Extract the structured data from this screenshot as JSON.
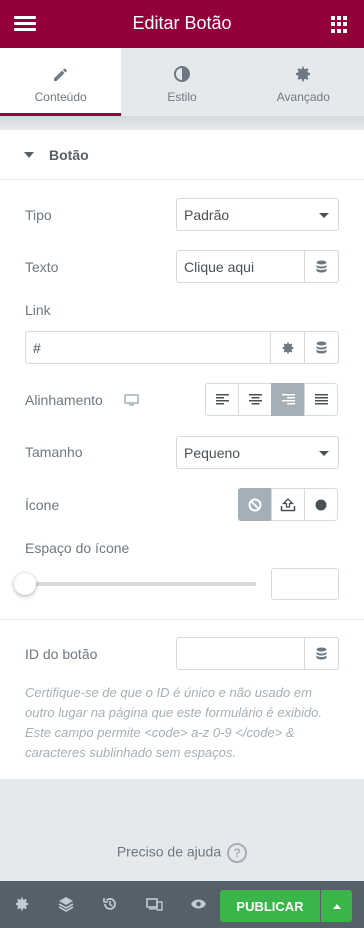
{
  "header": {
    "title": "Editar Botão",
    "menu_icon": "hamburger-icon",
    "apps_icon": "grid-icon",
    "background_color": "#93003c"
  },
  "tabs": [
    {
      "label": "Conteúdo",
      "icon": "pencil-icon",
      "active": true
    },
    {
      "label": "Estilo",
      "icon": "contrast-icon",
      "active": false
    },
    {
      "label": "Avançado",
      "icon": "gear-icon",
      "active": false
    }
  ],
  "section": {
    "title": "Botão"
  },
  "fields": {
    "tipo": {
      "label": "Tipo",
      "value": "Padrão"
    },
    "texto": {
      "label": "Texto",
      "value": "Clique aqui"
    },
    "link": {
      "label": "Link",
      "value": "#"
    },
    "alinhamento": {
      "label": "Alinhamento",
      "options": [
        "left",
        "center",
        "right",
        "justify"
      ],
      "selected": "right"
    },
    "tamanho": {
      "label": "Tamanho",
      "value": "Pequeno"
    },
    "icone": {
      "label": "Ícone",
      "options": [
        "none",
        "upload",
        "circle"
      ],
      "selected": "none"
    },
    "espaco_icone": {
      "label": "Espaço do ícone",
      "value": ""
    },
    "id_botao": {
      "label": "ID do botão",
      "value": "",
      "help": "Certifique-se de que o ID é único e não usado em outro lugar na página que este formulário é exibido. Este campo permite <code> a-z 0-9 </code> & caracteres sublinhado sem espaços."
    }
  },
  "footer": {
    "help_text": "Preciso de ajuda",
    "help_icon": "?",
    "publish_label": "PUBLICAR",
    "publish_color": "#39b54a"
  }
}
